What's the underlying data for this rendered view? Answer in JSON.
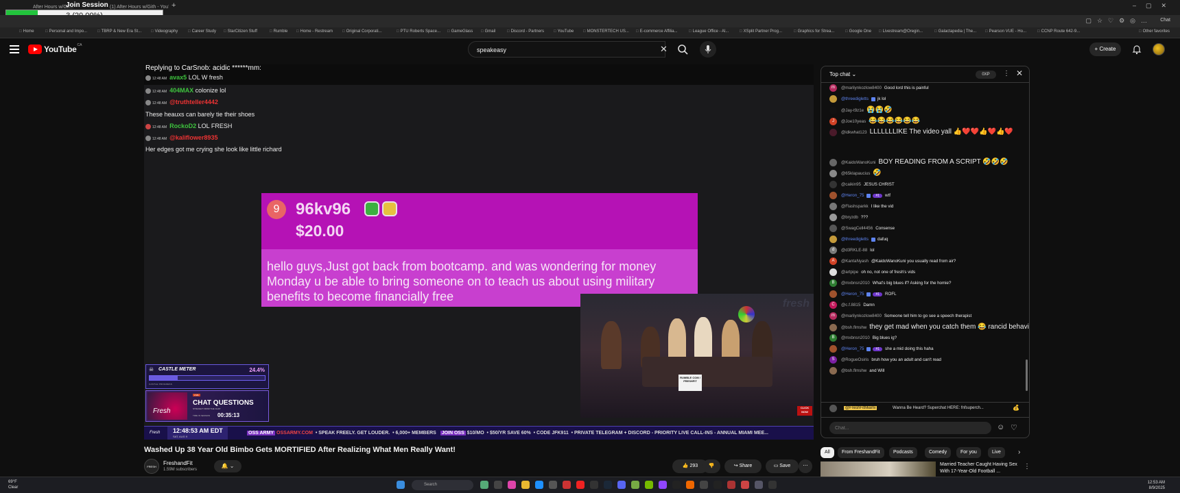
{
  "browser": {
    "tabs": [
      "After Hours w/Gir...",
      "(1) After Hours w/Gith - YouTube"
    ],
    "new_tab": "+",
    "chat_label": "Chat"
  },
  "join_session": {
    "title": "Join Session",
    "label": "3 (20.00%)",
    "progress_fraction": 0.2,
    "min": "0",
    "max": "15"
  },
  "bookmarks": [
    "Home",
    "Personal and Impo...",
    "TBRP & New Era St...",
    "Videography",
    "Career Study",
    "StarCitizen Stuff",
    "Rumble",
    "Home - Restream",
    "Original Corporati...",
    "PTU Roberts Space...",
    "GameGlass",
    "Gmail",
    "Discord - Partners",
    "YouTube",
    "MONSTERTECH US...",
    "E-commerce Affilia...",
    "League Office - Al...",
    "XSplit Partner Prog...",
    "Graphics for Strea...",
    "Google One",
    "Livestream@Oregin...",
    "Galactapedia | The...",
    "Pearson VUE - Ho...",
    "CCNP Route 642-9...",
    "Other favorites"
  ],
  "youtube": {
    "logo": "YouTube",
    "region": "CA",
    "search_value": "speakeasy",
    "create_label": "+ Create"
  },
  "chat_replay": {
    "replying": "Replying to CarSnob: acidic ******mm:",
    "lines": [
      {
        "time": "12:48 AM",
        "user": "avax5",
        "text": "LOL W fresh"
      },
      {
        "time": "12:48 AM",
        "user": "404MAX",
        "text": "colonize lol"
      },
      {
        "time": "12:48 AM",
        "user": "@truthteller4442",
        "text": ""
      },
      {
        "time": "",
        "user": "",
        "text": "These heauxs can barely tie their shoes"
      },
      {
        "time": "12:48 AM",
        "user": "RockoD2",
        "text": "LOL FRESH"
      },
      {
        "time": "12:48 AM",
        "user": "@kaliflower8935",
        "text": ""
      },
      {
        "time": "",
        "user": "",
        "text": "Her edges got me crying she look like little richard"
      }
    ]
  },
  "superchat": {
    "badge": "9",
    "name": "96kv96",
    "amount": "$20.00",
    "message": "hello guys,Just got back from bootcamp. and was wondering for money Monday u be able to bring someone on to teach us about using military benefits to become financially free"
  },
  "camera": {
    "logo": "fresh",
    "sign": "RUMBLE COM / FRESHFIT",
    "click": "CLICK NOW"
  },
  "castle_meter": {
    "title": "CASTLE METER",
    "percent": "24.4%",
    "fraction": 0.244,
    "sub": "CASTLE PROGRESS"
  },
  "chat_questions": {
    "thumb_label": "Fresh",
    "live": "LIVE",
    "title": "CHAT QUESTIONS",
    "sub": "STRAIGHT FROM THE CHAT",
    "time_label": "TIME IN SESSION",
    "time": "00:35:13"
  },
  "ticker": {
    "logo": "Fresh",
    "clock": "12:48:53 AM EDT",
    "date": "SAT, AUG 9",
    "army": "OSS ARMY",
    "site": "OSSARMY.COM",
    "items": [
      "SPEAK FREELY. GET LOUDER.",
      "6,000+ MEMBERS",
      "JOIN OSS",
      "$10/MO",
      "$50/YR SAVE 60%",
      "CODE JFK911",
      "PRIVATE TELEGRAM + DISCORD - PRIORITY LIVE CALL-INS - ANNUAL MIAMI MEE..."
    ]
  },
  "video": {
    "title": "Washed Up 38 Year Old Bimbo Gets MORTIFIED After Realizing What Men Really Want!",
    "channel": "FreshandFit",
    "subscribers": "1.59M subscribers",
    "likes": "293",
    "share": "Share",
    "save": "Save"
  },
  "chat": {
    "mode": "Top chat",
    "xp": "0XP",
    "pinned_user": "@FreshFitMiami",
    "pinned_msg": "Wanna Be Heard? Superchat HERE: fnfsuperch...",
    "placeholder": "Chat...",
    "messages": [
      {
        "user": "@marilynkozlow8400",
        "text": "Good lord this is painful",
        "color": "#b52a5e",
        "initial": "m",
        "member": false,
        "badge": ""
      },
      {
        "user": "@threedigletts",
        "text": "jk lol",
        "color": "#c49a3a",
        "initial": "",
        "member": true,
        "badge": ""
      },
      {
        "user": "@Jay-t9z1e",
        "text": "😭😭🤣",
        "color": "#111111",
        "initial": "",
        "member": false,
        "badge": ""
      },
      {
        "user": "@Joe10yeas",
        "text": "😂😂😂😂😂😂",
        "color": "#d14226",
        "initial": "J",
        "member": false,
        "badge": ""
      },
      {
        "user": "@idkwhat123",
        "text": "LLLLLLLIKE The video yall 👍❤️❤️👍❤️👍❤️",
        "color": "#4a1a2a",
        "initial": "",
        "member": false,
        "badge": ""
      },
      {
        "user": "@KaidoWanoKuni",
        "text": "BOY READING FROM A SCRIPT 🤣🤣🤣",
        "color": "#666666",
        "initial": "",
        "member": false,
        "badge": ""
      },
      {
        "user": "@65klapaucius",
        "text": "🤣",
        "color": "#888888",
        "initial": "",
        "member": false,
        "badge": ""
      },
      {
        "user": "@caikin95",
        "text": "JESUS CHRIST",
        "color": "#333333",
        "initial": "",
        "member": false,
        "badge": ""
      },
      {
        "user": "@Heron_75",
        "text": "wtf",
        "color": "#a0522d",
        "initial": "",
        "member": true,
        "badge": "#1"
      },
      {
        "user": "@Flashsparkk",
        "text": "I like the vid",
        "color": "#777777",
        "initial": "",
        "member": false,
        "badge": ""
      },
      {
        "user": "@bryzdb",
        "text": "???",
        "color": "#999999",
        "initial": "",
        "member": false,
        "badge": ""
      },
      {
        "user": "@SwagCell4456",
        "text": "Consense",
        "color": "#555555",
        "initial": "",
        "member": false,
        "badge": ""
      },
      {
        "user": "@threedigletts",
        "text": "dafuq",
        "color": "#c49a3a",
        "initial": "",
        "member": true,
        "badge": ""
      },
      {
        "user": "@d3RKLE-88",
        "text": "lol",
        "color": "#7a7a7a",
        "initial": "d",
        "member": false,
        "badge": ""
      },
      {
        "user": "@KantaNyash",
        "text": "@KaidoWanoKuni you usually read from air?",
        "color": "#d14226",
        "initial": "A",
        "member": false,
        "badge": ""
      },
      {
        "user": "@artpipe",
        "text": "oh no, not one of fresh's vids",
        "color": "#dddddd",
        "initial": "",
        "member": false,
        "badge": ""
      },
      {
        "user": "@mxbnsn2010",
        "text": "What's big blues if? Asking for the homie?",
        "color": "#2e7d32",
        "initial": "B",
        "member": false,
        "badge": ""
      },
      {
        "user": "@Heron_75",
        "text": "ROFL",
        "color": "#a0522d",
        "initial": "",
        "member": true,
        "badge": "#1"
      },
      {
        "user": "@c.f.8815",
        "text": "Damn",
        "color": "#c2185b",
        "initial": "C",
        "member": false,
        "badge": ""
      },
      {
        "user": "@marilynkozlow8400",
        "text": "Someone tell him to go see a speech therapist",
        "color": "#b52a5e",
        "initial": "m",
        "member": false,
        "badge": ""
      },
      {
        "user": "@bsh.flmshw",
        "text": "they get mad when you catch them 😂 rancid behavior",
        "color": "#8a6a50",
        "initial": "",
        "member": false,
        "badge": ""
      },
      {
        "user": "@mxbnsn2010",
        "text": "Big blues ig?",
        "color": "#2e7d32",
        "initial": "B",
        "member": false,
        "badge": ""
      },
      {
        "user": "@Heron_75",
        "text": "she a mid doing this haha",
        "color": "#a0522d",
        "initial": "",
        "member": true,
        "badge": "#1"
      },
      {
        "user": "@RogueOsiris",
        "text": "bruh how you an adult and can't read",
        "color": "#7b1fa2",
        "initial": "S",
        "member": false,
        "badge": ""
      },
      {
        "user": "@bsh.flmshw",
        "text": "and Will",
        "color": "#8a6a50",
        "initial": "",
        "member": false,
        "badge": ""
      }
    ]
  },
  "chips": [
    "All",
    "From FreshandFit",
    "Podcasts",
    "Comedy",
    "For you",
    "Live"
  ],
  "recommended": {
    "title": "Married Teacher Caught Having Sex With 17-Year-Old Football ..."
  },
  "taskbar": {
    "temp": "69°F",
    "weather": "Clear",
    "search": "Search",
    "time": "12:53 AM",
    "date": "8/9/2025"
  }
}
